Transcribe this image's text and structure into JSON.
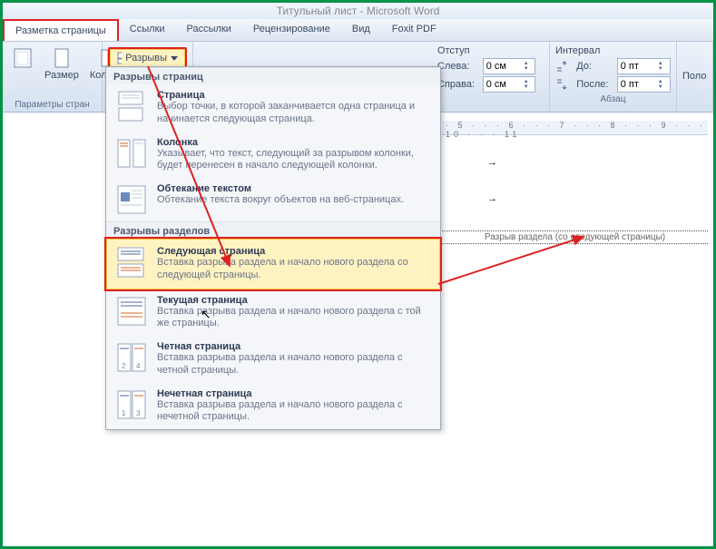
{
  "title": "Титульный лист - Microsoft Word",
  "tabs": [
    "Разметка страницы",
    "Ссылки",
    "Рассылки",
    "Рецензирование",
    "Вид",
    "Foxit PDF"
  ],
  "active_tab_index": 0,
  "ribbon": {
    "page_setup": {
      "size_label": "Размер",
      "columns_label": "Колонки",
      "group_label": "Параметры стран",
      "breaks_button": "Разрывы"
    },
    "indent": {
      "header": "Отступ",
      "left_label": "Слева:",
      "right_label": "Справа:",
      "left_value": "0 см",
      "right_value": "0 см"
    },
    "spacing": {
      "header": "Интервал",
      "before_label": "До:",
      "after_label": "После:",
      "before_value": "0 пт",
      "after_value": "0 пт",
      "group_label": "Абзац"
    },
    "truncated_label": "Поло"
  },
  "dropdown": {
    "section1_header": "Разрывы страниц",
    "section2_header": "Разрывы разделов",
    "items_pages": [
      {
        "title": "Страница",
        "desc": "Выбор точки, в которой заканчивается одна страница и начинается следующая страница."
      },
      {
        "title": "Колонка",
        "desc": "Указывает, что текст, следующий за разрывом колонки, будет перенесен в начало следующей колонки."
      },
      {
        "title": "Обтекание текстом",
        "desc": "Обтекание текста вокруг объектов на веб-страницах."
      }
    ],
    "items_sections": [
      {
        "title": "Следующая страница",
        "desc": "Вставка разрыва раздела и начало нового раздела со следующей страницы."
      },
      {
        "title": "Текущая страница",
        "desc": "Вставка разрыва раздела и начало нового раздела с той же страницы."
      },
      {
        "title": "Четная страница",
        "desc": "Вставка разрыва раздела и начало нового раздела с четной страницы."
      },
      {
        "title": "Нечетная страница",
        "desc": "Вставка разрыва раздела и начало нового раздела с нечетной страницы."
      }
    ]
  },
  "document": {
    "ruler_ticks": "· 5 · · · 6 · · · 7 · · · 8 · · · 9 · · · 10 · · · 11",
    "section_break_text": "Разрыв раздела (со следующей страницы)"
  }
}
